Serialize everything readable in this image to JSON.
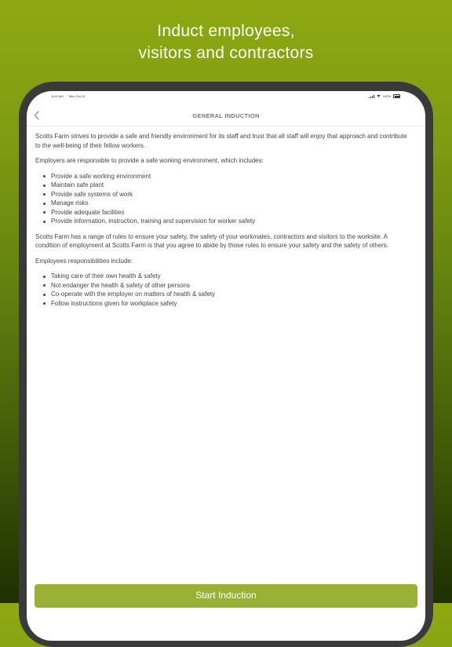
{
  "promo": {
    "line1": "Induct employees,",
    "line2": "visitors and contractors"
  },
  "status_bar": {
    "time": "8:41 AM",
    "date": "Mon Oct 12",
    "battery": "100%"
  },
  "nav": {
    "title": "GENERAL INDUCTION",
    "back_icon": "chevron-left-icon"
  },
  "content": {
    "intro": "Scotts Farm strives to provide a safe and friendly environment for its staff and trust that all staff will enjoy that approach and contribute to the well-being of their fellow workers.",
    "employers_heading": "Employers are responsible to provide a safe working environment, which includes:",
    "employer_items": [
      "Provide a safe working environment",
      "Maintain safe plant",
      "Provide safe systems of work",
      "Manage risks",
      "Provide adequate facilities",
      "Provide information, instruction, training and supervision for worker safety"
    ],
    "rules": "Scotts Farm has a range of rules to ensure your safety, the safety of your workmates, contractors and visitors to the worksite. A condition of employment at Scotts Farm is that you agree to abide by those rules to ensure your safety and the safety of others.",
    "employees_heading": "Employees responsibilities include:",
    "employee_items": [
      "Taking care of their own health & safety",
      "Not endanger the health & safety of other persons",
      "Co-operate with the employer on matters of health & safety",
      "Follow instructions given for workplace safety"
    ]
  },
  "actions": {
    "start_label": "Start Induction"
  },
  "colors": {
    "button": "#9bb037",
    "background_top": "#8fa812",
    "background_bottom": "#1e2f02"
  }
}
